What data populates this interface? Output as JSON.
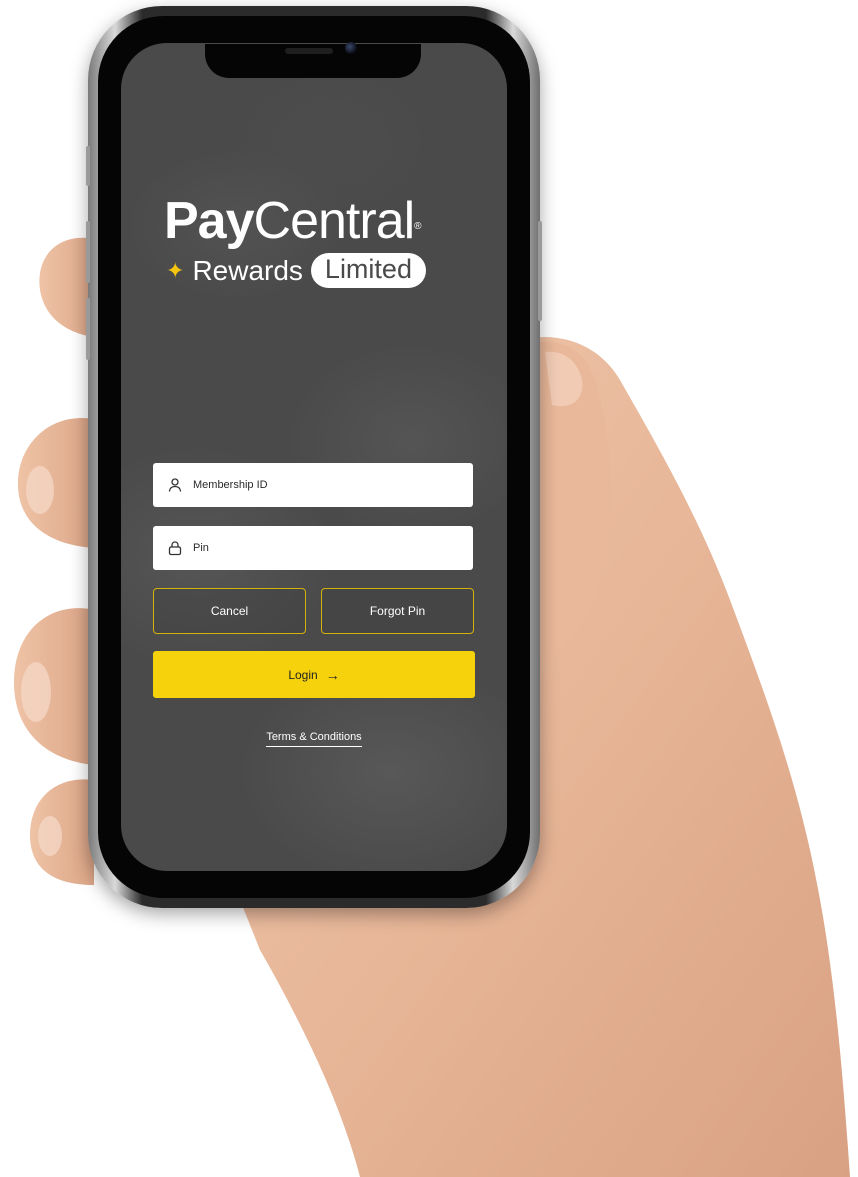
{
  "app": {
    "brand_primary": "Pay",
    "brand_secondary": "Central",
    "brand_mark": "®",
    "brand_sub": "Rewards",
    "brand_badge": "Limited",
    "star_icon": "sparkle-star-icon"
  },
  "login_form": {
    "membership_placeholder": "Membership ID",
    "pin_placeholder": "Pin",
    "cancel_label": "Cancel",
    "forgot_label": "Forgot Pin",
    "login_label": "Login",
    "login_icon": "arrow-right-icon",
    "terms_label": "Terms & Conditions"
  },
  "colors": {
    "accent": "#F5D20B",
    "outline": "#D4B20B",
    "screen_bg": "#4A4A4A",
    "text_light": "#FFFFFF"
  }
}
